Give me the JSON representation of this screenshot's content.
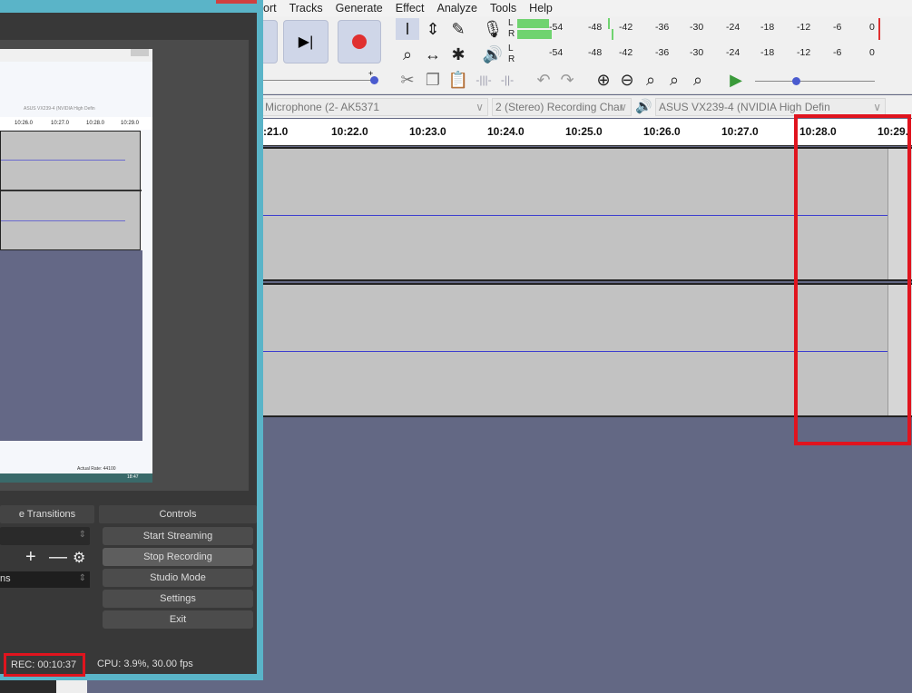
{
  "audacity": {
    "menu": [
      "ort",
      "Tracks",
      "Generate",
      "Effect",
      "Analyze",
      "Tools",
      "Help"
    ],
    "meter_ticks": [
      "-54",
      "-48",
      "-42",
      "-36",
      "-30",
      "-24",
      "-18",
      "-12",
      "-6",
      "0"
    ],
    "rec_meter_channels": [
      "L",
      "R"
    ],
    "play_meter_channels": [
      "L",
      "R"
    ],
    "slider_minus": "-",
    "slider_plus": "+",
    "recording_device": "Microphone (2- AK5371",
    "channels": "2 (Stereo) Recording Char",
    "playback_device": "ASUS VX239-4 (NVIDIA High Defin",
    "ruler": [
      ":21.0",
      "10:22.0",
      "10:23.0",
      "10:24.0",
      "10:25.0",
      "10:26.0",
      "10:27.0",
      "10:28.0",
      "10:29."
    ],
    "colors": {
      "meter_green": "#6fd36f",
      "waveform_line": "#3d3ecf",
      "highlight": "#e0141e"
    }
  },
  "obs": {
    "preview": {
      "ruler": [
        "10:26.0",
        "10:27.0",
        "10:28.0",
        "10:29.0"
      ],
      "status": "Actual Rate: 44100",
      "device": "ASUS VX239-4 (NVIDIA High Defin",
      "clock": "18:47"
    },
    "transitions_header": "e Transitions",
    "controls_header": "Controls",
    "transition_value": "ns",
    "buttons": [
      "Start Streaming",
      "Stop Recording",
      "Studio Mode",
      "Settings",
      "Exit"
    ],
    "rec_time": "REC: 00:10:37",
    "cpu": "CPU: 3.9%, 30.00 fps"
  }
}
